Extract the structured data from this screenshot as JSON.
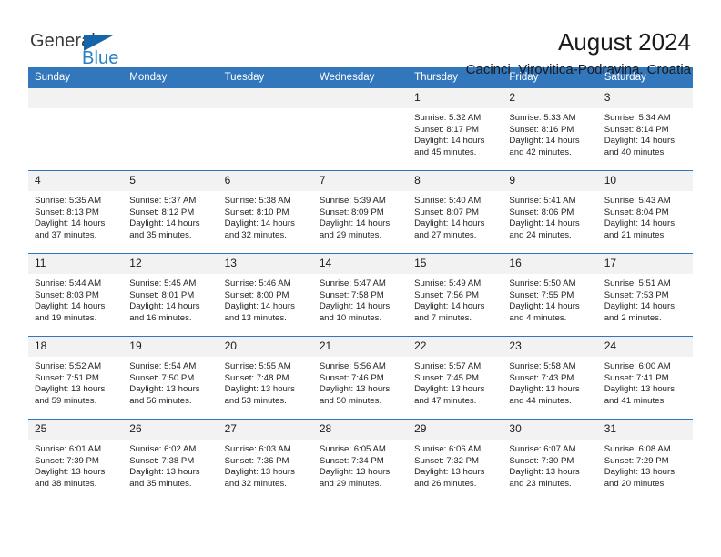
{
  "brand": {
    "name_dark": "General",
    "name_blue": "Blue",
    "logo_icon": "triangle-flag-icon",
    "accent_color": "#2a7fc1",
    "header_color": "#3277bc"
  },
  "header": {
    "title": "August 2024",
    "subtitle": "Cacinci, Virovitica-Podravina, Croatia"
  },
  "weekday_headers": [
    "Sunday",
    "Monday",
    "Tuesday",
    "Wednesday",
    "Thursday",
    "Friday",
    "Saturday"
  ],
  "labels": {
    "sunrise": "Sunrise:",
    "sunset": "Sunset:",
    "daylight": "Daylight:"
  },
  "weeks": [
    [
      {
        "day": "",
        "sunrise": "",
        "sunset": "",
        "daylight_line1": "",
        "daylight_line2": ""
      },
      {
        "day": "",
        "sunrise": "",
        "sunset": "",
        "daylight_line1": "",
        "daylight_line2": ""
      },
      {
        "day": "",
        "sunrise": "",
        "sunset": "",
        "daylight_line1": "",
        "daylight_line2": ""
      },
      {
        "day": "",
        "sunrise": "",
        "sunset": "",
        "daylight_line1": "",
        "daylight_line2": ""
      },
      {
        "day": "1",
        "sunrise": "Sunrise: 5:32 AM",
        "sunset": "Sunset: 8:17 PM",
        "daylight_line1": "Daylight: 14 hours",
        "daylight_line2": "and 45 minutes."
      },
      {
        "day": "2",
        "sunrise": "Sunrise: 5:33 AM",
        "sunset": "Sunset: 8:16 PM",
        "daylight_line1": "Daylight: 14 hours",
        "daylight_line2": "and 42 minutes."
      },
      {
        "day": "3",
        "sunrise": "Sunrise: 5:34 AM",
        "sunset": "Sunset: 8:14 PM",
        "daylight_line1": "Daylight: 14 hours",
        "daylight_line2": "and 40 minutes."
      }
    ],
    [
      {
        "day": "4",
        "sunrise": "Sunrise: 5:35 AM",
        "sunset": "Sunset: 8:13 PM",
        "daylight_line1": "Daylight: 14 hours",
        "daylight_line2": "and 37 minutes."
      },
      {
        "day": "5",
        "sunrise": "Sunrise: 5:37 AM",
        "sunset": "Sunset: 8:12 PM",
        "daylight_line1": "Daylight: 14 hours",
        "daylight_line2": "and 35 minutes."
      },
      {
        "day": "6",
        "sunrise": "Sunrise: 5:38 AM",
        "sunset": "Sunset: 8:10 PM",
        "daylight_line1": "Daylight: 14 hours",
        "daylight_line2": "and 32 minutes."
      },
      {
        "day": "7",
        "sunrise": "Sunrise: 5:39 AM",
        "sunset": "Sunset: 8:09 PM",
        "daylight_line1": "Daylight: 14 hours",
        "daylight_line2": "and 29 minutes."
      },
      {
        "day": "8",
        "sunrise": "Sunrise: 5:40 AM",
        "sunset": "Sunset: 8:07 PM",
        "daylight_line1": "Daylight: 14 hours",
        "daylight_line2": "and 27 minutes."
      },
      {
        "day": "9",
        "sunrise": "Sunrise: 5:41 AM",
        "sunset": "Sunset: 8:06 PM",
        "daylight_line1": "Daylight: 14 hours",
        "daylight_line2": "and 24 minutes."
      },
      {
        "day": "10",
        "sunrise": "Sunrise: 5:43 AM",
        "sunset": "Sunset: 8:04 PM",
        "daylight_line1": "Daylight: 14 hours",
        "daylight_line2": "and 21 minutes."
      }
    ],
    [
      {
        "day": "11",
        "sunrise": "Sunrise: 5:44 AM",
        "sunset": "Sunset: 8:03 PM",
        "daylight_line1": "Daylight: 14 hours",
        "daylight_line2": "and 19 minutes."
      },
      {
        "day": "12",
        "sunrise": "Sunrise: 5:45 AM",
        "sunset": "Sunset: 8:01 PM",
        "daylight_line1": "Daylight: 14 hours",
        "daylight_line2": "and 16 minutes."
      },
      {
        "day": "13",
        "sunrise": "Sunrise: 5:46 AM",
        "sunset": "Sunset: 8:00 PM",
        "daylight_line1": "Daylight: 14 hours",
        "daylight_line2": "and 13 minutes."
      },
      {
        "day": "14",
        "sunrise": "Sunrise: 5:47 AM",
        "sunset": "Sunset: 7:58 PM",
        "daylight_line1": "Daylight: 14 hours",
        "daylight_line2": "and 10 minutes."
      },
      {
        "day": "15",
        "sunrise": "Sunrise: 5:49 AM",
        "sunset": "Sunset: 7:56 PM",
        "daylight_line1": "Daylight: 14 hours",
        "daylight_line2": "and 7 minutes."
      },
      {
        "day": "16",
        "sunrise": "Sunrise: 5:50 AM",
        "sunset": "Sunset: 7:55 PM",
        "daylight_line1": "Daylight: 14 hours",
        "daylight_line2": "and 4 minutes."
      },
      {
        "day": "17",
        "sunrise": "Sunrise: 5:51 AM",
        "sunset": "Sunset: 7:53 PM",
        "daylight_line1": "Daylight: 14 hours",
        "daylight_line2": "and 2 minutes."
      }
    ],
    [
      {
        "day": "18",
        "sunrise": "Sunrise: 5:52 AM",
        "sunset": "Sunset: 7:51 PM",
        "daylight_line1": "Daylight: 13 hours",
        "daylight_line2": "and 59 minutes."
      },
      {
        "day": "19",
        "sunrise": "Sunrise: 5:54 AM",
        "sunset": "Sunset: 7:50 PM",
        "daylight_line1": "Daylight: 13 hours",
        "daylight_line2": "and 56 minutes."
      },
      {
        "day": "20",
        "sunrise": "Sunrise: 5:55 AM",
        "sunset": "Sunset: 7:48 PM",
        "daylight_line1": "Daylight: 13 hours",
        "daylight_line2": "and 53 minutes."
      },
      {
        "day": "21",
        "sunrise": "Sunrise: 5:56 AM",
        "sunset": "Sunset: 7:46 PM",
        "daylight_line1": "Daylight: 13 hours",
        "daylight_line2": "and 50 minutes."
      },
      {
        "day": "22",
        "sunrise": "Sunrise: 5:57 AM",
        "sunset": "Sunset: 7:45 PM",
        "daylight_line1": "Daylight: 13 hours",
        "daylight_line2": "and 47 minutes."
      },
      {
        "day": "23",
        "sunrise": "Sunrise: 5:58 AM",
        "sunset": "Sunset: 7:43 PM",
        "daylight_line1": "Daylight: 13 hours",
        "daylight_line2": "and 44 minutes."
      },
      {
        "day": "24",
        "sunrise": "Sunrise: 6:00 AM",
        "sunset": "Sunset: 7:41 PM",
        "daylight_line1": "Daylight: 13 hours",
        "daylight_line2": "and 41 minutes."
      }
    ],
    [
      {
        "day": "25",
        "sunrise": "Sunrise: 6:01 AM",
        "sunset": "Sunset: 7:39 PM",
        "daylight_line1": "Daylight: 13 hours",
        "daylight_line2": "and 38 minutes."
      },
      {
        "day": "26",
        "sunrise": "Sunrise: 6:02 AM",
        "sunset": "Sunset: 7:38 PM",
        "daylight_line1": "Daylight: 13 hours",
        "daylight_line2": "and 35 minutes."
      },
      {
        "day": "27",
        "sunrise": "Sunrise: 6:03 AM",
        "sunset": "Sunset: 7:36 PM",
        "daylight_line1": "Daylight: 13 hours",
        "daylight_line2": "and 32 minutes."
      },
      {
        "day": "28",
        "sunrise": "Sunrise: 6:05 AM",
        "sunset": "Sunset: 7:34 PM",
        "daylight_line1": "Daylight: 13 hours",
        "daylight_line2": "and 29 minutes."
      },
      {
        "day": "29",
        "sunrise": "Sunrise: 6:06 AM",
        "sunset": "Sunset: 7:32 PM",
        "daylight_line1": "Daylight: 13 hours",
        "daylight_line2": "and 26 minutes."
      },
      {
        "day": "30",
        "sunrise": "Sunrise: 6:07 AM",
        "sunset": "Sunset: 7:30 PM",
        "daylight_line1": "Daylight: 13 hours",
        "daylight_line2": "and 23 minutes."
      },
      {
        "day": "31",
        "sunrise": "Sunrise: 6:08 AM",
        "sunset": "Sunset: 7:29 PM",
        "daylight_line1": "Daylight: 13 hours",
        "daylight_line2": "and 20 minutes."
      }
    ]
  ]
}
